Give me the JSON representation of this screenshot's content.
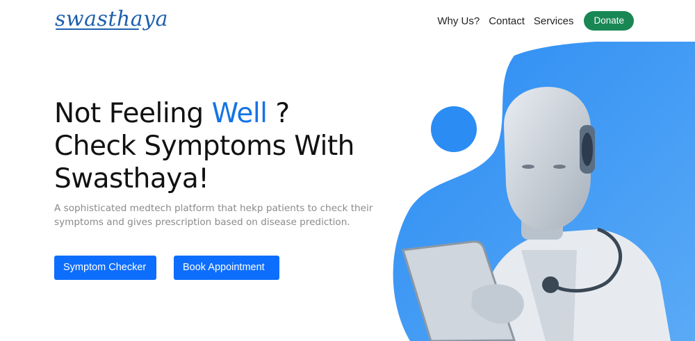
{
  "brand": {
    "logo_text": "swasthaya",
    "colors": {
      "logo": "#1e5fb0",
      "accent": "#1473e6",
      "donate": "#198754",
      "button": "#0d6efd",
      "blob": "#3b9af5"
    }
  },
  "nav": {
    "links": [
      "Why Us?",
      "Contact",
      "Services"
    ],
    "donate_label": "Donate"
  },
  "hero": {
    "title_line1_prefix": "Not Feeling ",
    "title_line1_accent": "Well",
    "title_line1_suffix": " ?",
    "title_line2": "Check Symptoms With",
    "title_line3": "Swasthaya!",
    "description": "A sophisticated medtech platform that hekp patients to check their symptoms and gives prescription based on disease prediction.",
    "buttons": {
      "symptom_checker": "Symptom Checker",
      "book_appointment": "Book Appointment"
    }
  },
  "illustration": {
    "icon": "robot-doctor-with-tablet-illustration"
  }
}
